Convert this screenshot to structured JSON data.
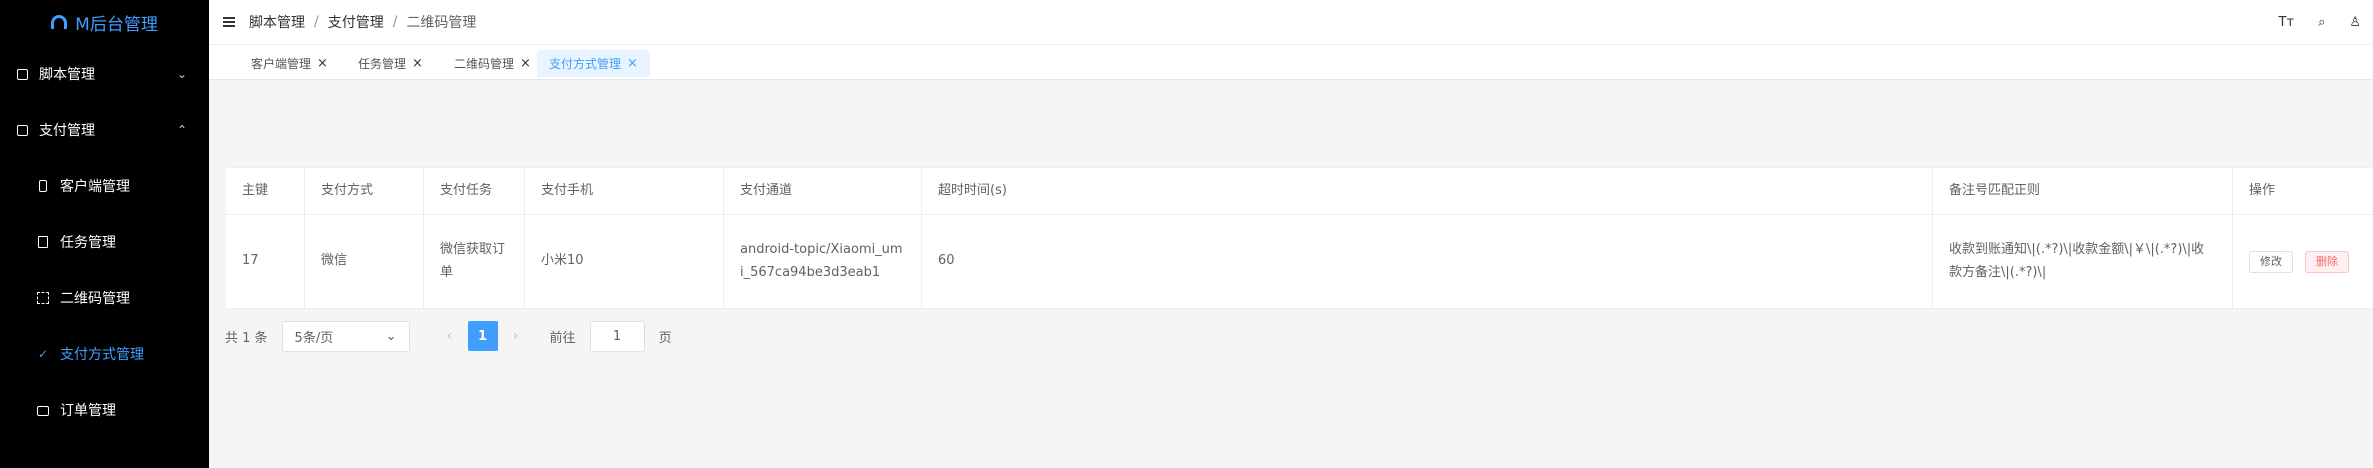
{
  "app": {
    "title": "M后台管理"
  },
  "sidebar": {
    "items": [
      {
        "label": "脚本管理",
        "icon": "box-icon"
      },
      {
        "label": "支付管理",
        "icon": "wallet-icon"
      },
      {
        "label": "客户端管理",
        "icon": "phone-icon"
      },
      {
        "label": "任务管理",
        "icon": "document-icon"
      },
      {
        "label": "二维码管理",
        "icon": "scan-icon"
      },
      {
        "label": "支付方式管理",
        "icon": "check-icon"
      },
      {
        "label": "订单管理",
        "icon": "bag-icon"
      }
    ],
    "expand_glyph": "⌄",
    "collapse_glyph": "⌃"
  },
  "header": {
    "breadcrumb": [
      "脚本管理",
      "支付管理",
      "二维码管理"
    ],
    "separator": "/",
    "icons": {
      "font_size": "Tт",
      "search": "⌕",
      "theme": "♙"
    }
  },
  "tabs": [
    {
      "label": "客户端管理",
      "close": "×"
    },
    {
      "label": "任务管理",
      "close": "×"
    },
    {
      "label": "二维码管理",
      "close": "×"
    },
    {
      "label": "支付方式管理",
      "close": "×"
    }
  ],
  "table": {
    "headers": [
      "主键",
      "支付方式",
      "支付任务",
      "支付手机",
      "支付通道",
      "超时时间(s)",
      "备注号匹配正则",
      "操作"
    ],
    "rows": [
      {
        "id": "17",
        "method": "微信",
        "task": "微信获取订单",
        "phone": "小米10",
        "channel": "android-topic/Xiaomi_umi_567ca94be3d3eab1",
        "timeout": "60",
        "regex": "收款到账通知\\|(.*?)\\|收款金额\\|￥\\|(.*?)\\|收款方备注\\|(.*?)\\|",
        "edit": "修改",
        "delete": "删除"
      }
    ]
  },
  "pagination": {
    "total": "共 1 条",
    "page_size": "5条/页",
    "prev": "‹",
    "current": "1",
    "next": "›",
    "goto_label": "前往",
    "goto_value": "1",
    "page_suffix": "页",
    "dropdown_glyph": "⌄"
  },
  "colors": {
    "accent": "#409eff",
    "sidebar_bg": "#000000",
    "danger": "#f56c6c"
  }
}
